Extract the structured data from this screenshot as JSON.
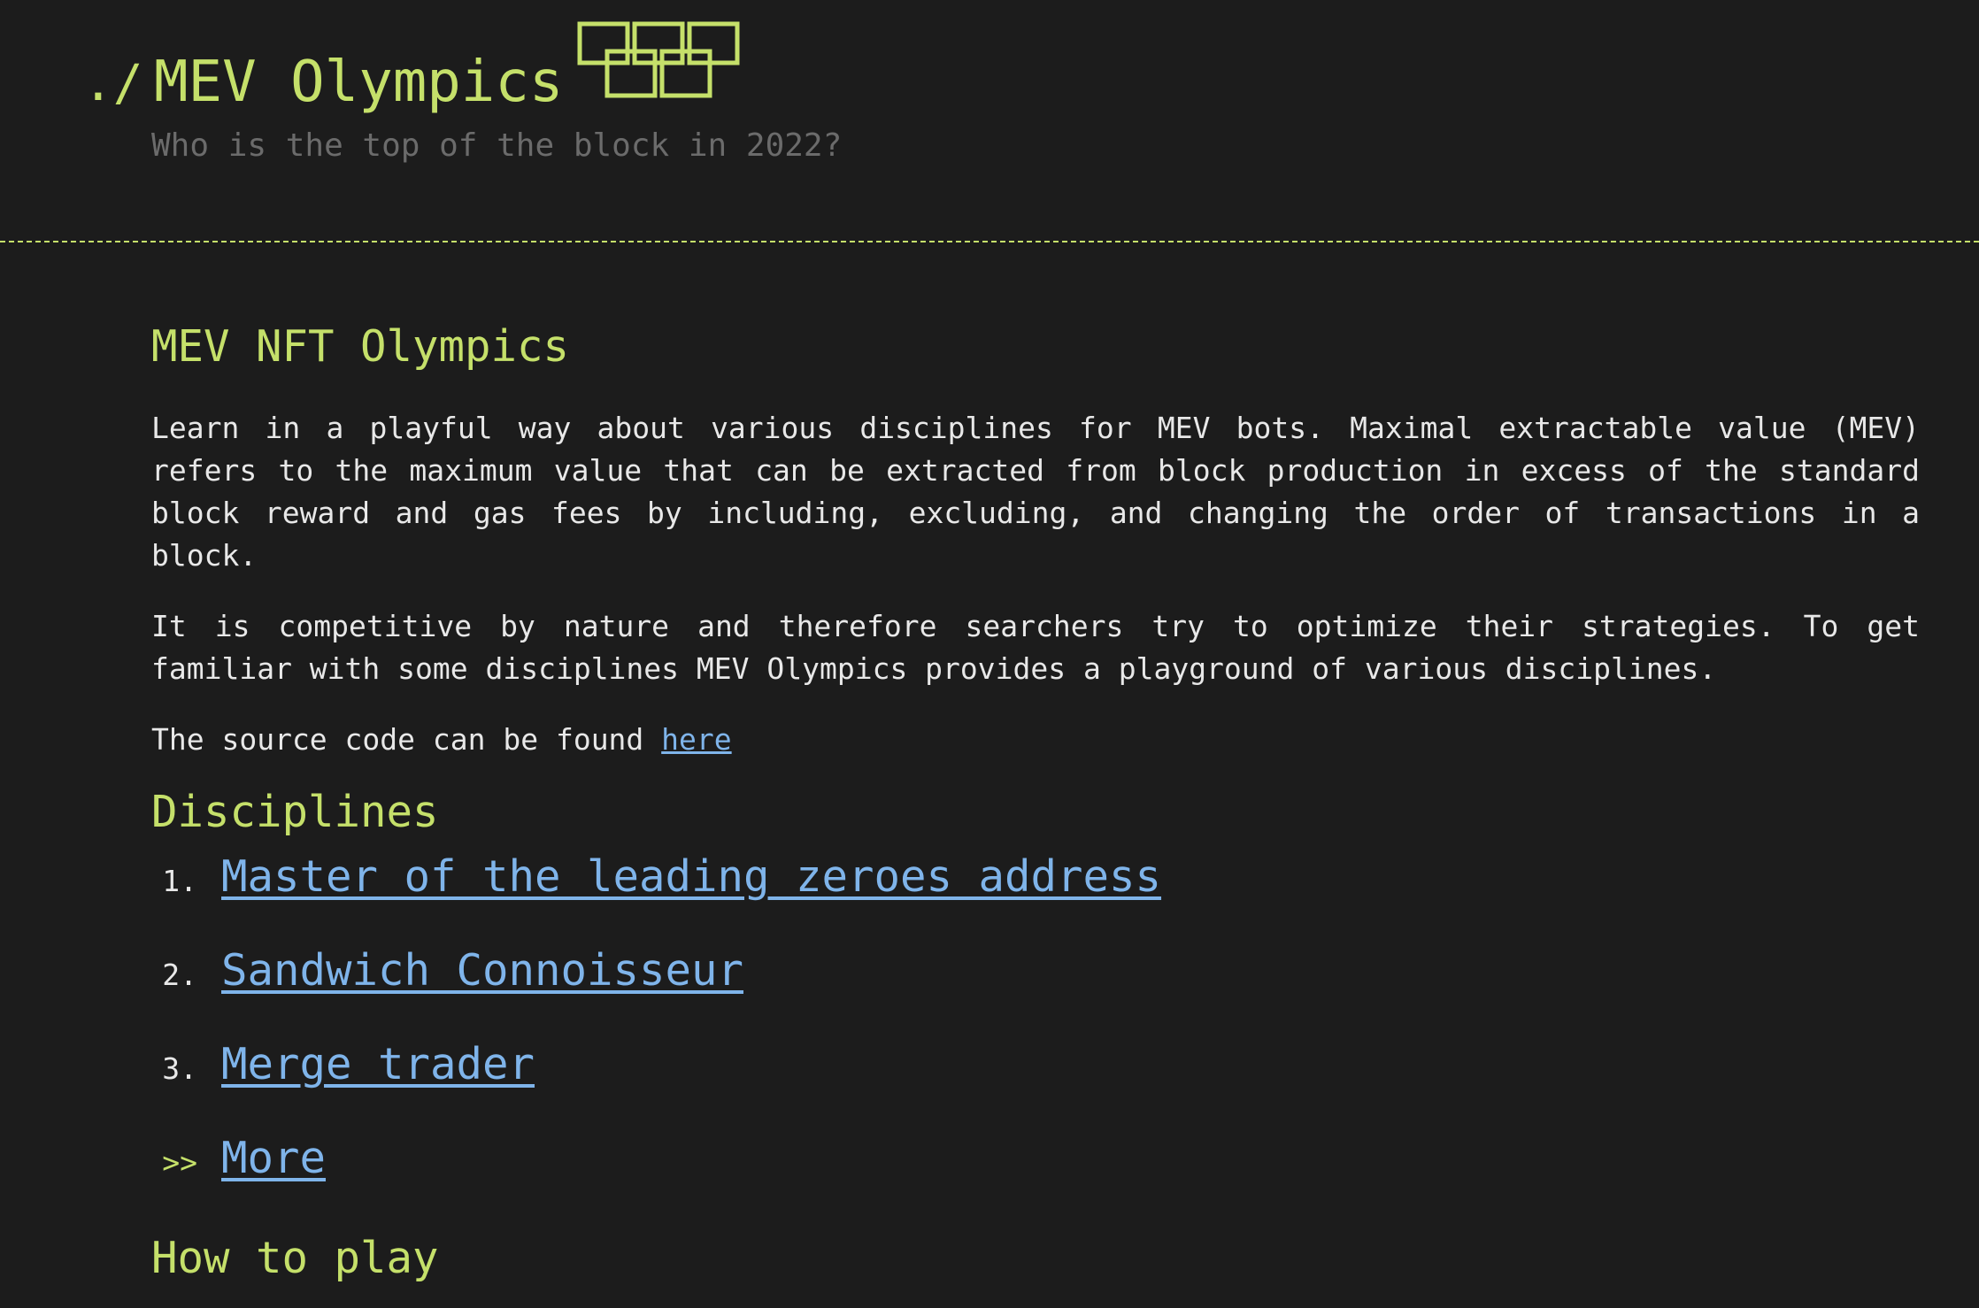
{
  "header": {
    "prompt": "./",
    "title": "MEV Olympics",
    "subtitle": "Who is the top of the block in 2022?",
    "logo_icon": "olympic-rings-icon",
    "accent_color": "#c5e06a"
  },
  "intro": {
    "heading": "MEV NFT Olympics",
    "paragraph1": "Learn in a playful way about various disciplines for MEV bots. Maximal extractable value (MEV) refers to the maximum value that can be extracted from block production in excess of the standard block reward and gas fees by including, excluding, and changing the order of transactions in a block.",
    "paragraph2": "It is competitive by nature and therefore searchers try to optimize their strategies. To get familiar with some disciplines MEV Olympics provides a playground of various disciplines.",
    "source_text": "The source code can be found",
    "source_link": "here"
  },
  "disciplines": {
    "heading": "Disciplines",
    "items": [
      {
        "number": "1.",
        "label": "Master of the leading zeroes address"
      },
      {
        "number": "2.",
        "label": "Sandwich Connoisseur"
      },
      {
        "number": "3.",
        "label": "Merge trader"
      }
    ],
    "more_marker": ">>",
    "more_label": "More"
  },
  "how_to_play": {
    "heading": "How to play"
  },
  "colors": {
    "background": "#1c1c1c",
    "accent": "#c5e06a",
    "link": "#7fb4ea",
    "text": "#e8e8e8",
    "muted": "#6b6b6b"
  }
}
